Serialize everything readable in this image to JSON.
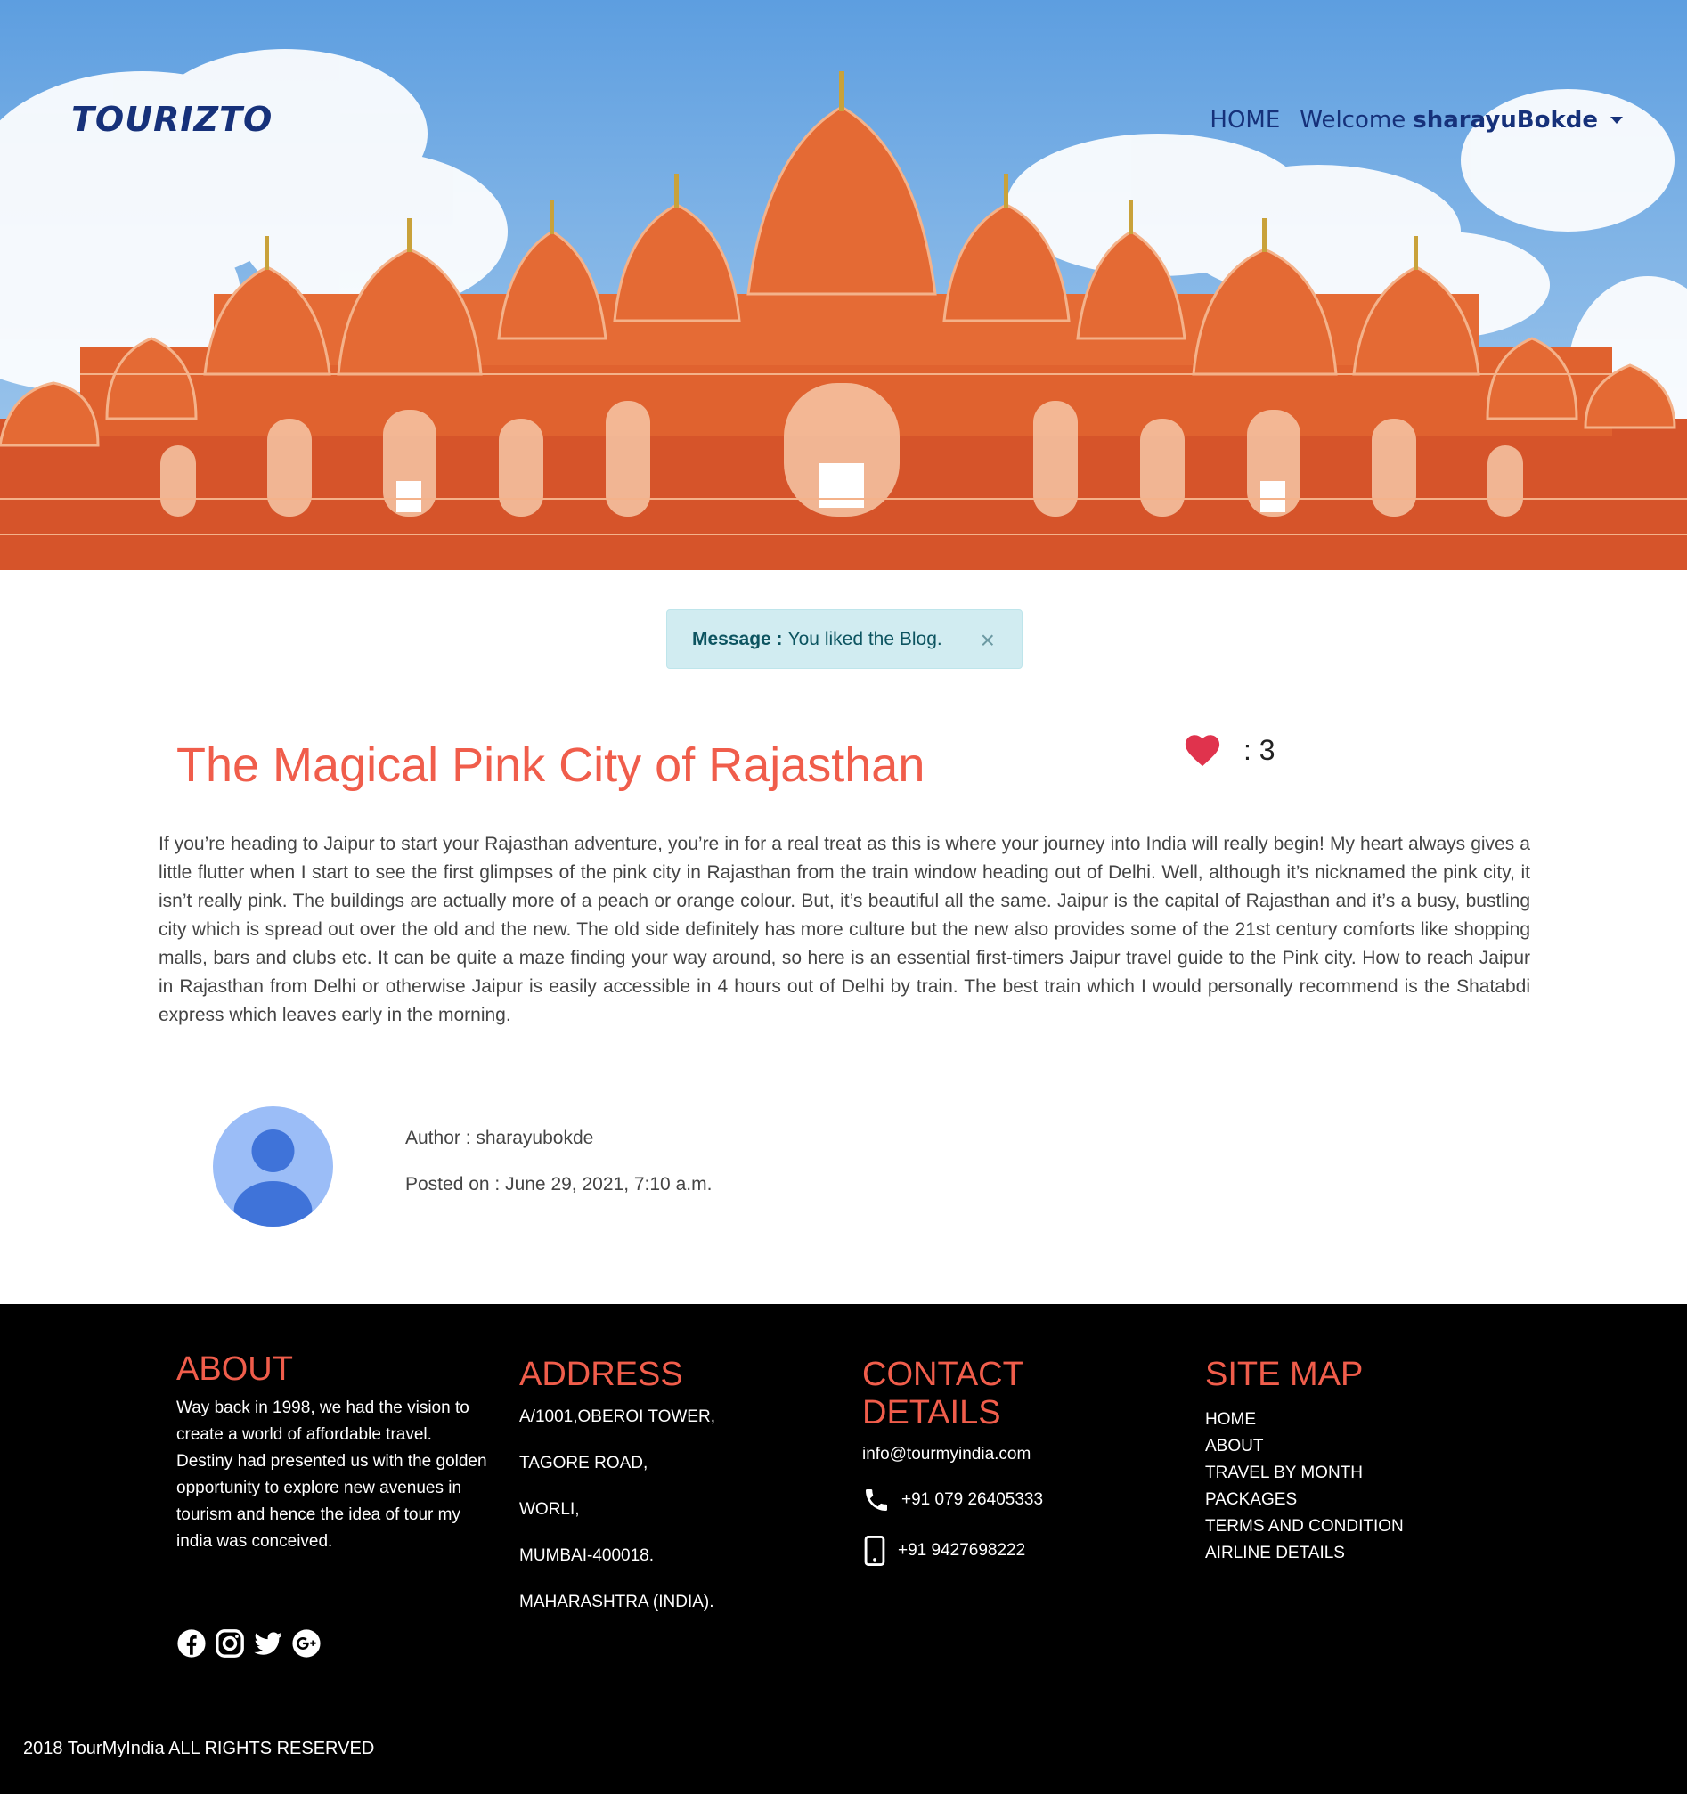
{
  "header": {
    "logo": "TOURIZTO",
    "nav_home": "HOME",
    "welcome_prefix": "Welcome",
    "username": "sharayuBokde"
  },
  "alert": {
    "label": "Message :",
    "text": "You liked the Blog.",
    "close": "×"
  },
  "blog": {
    "title": "The Magical Pink City of Rajasthan",
    "likes": ": 3",
    "body": "If you’re heading to Jaipur to start your Rajasthan adventure, you’re in for a real treat as this is where your journey into India will really begin! My heart always gives a little flutter when I start to see the first glimpses of the pink city in Rajasthan from the train window heading out of Delhi. Well, although it’s nicknamed the pink city, it isn’t really pink. The buildings are actually more of a peach or orange colour. But, it’s beautiful all the same. Jaipur is the capital of Rajasthan and it’s a busy, bustling city which is spread out over the old and the new. The old side definitely has more culture but the new also provides some of the 21st century comforts like shopping malls, bars and clubs etc. It can be quite a maze finding your way around, so here is an essential first-timers Jaipur travel guide to the Pink city. How to reach Jaipur in Rajasthan from Delhi or otherwise Jaipur is easily accessible in 4 hours out of Delhi by train. The best train which I would personally recommend is the Shatabdi express which leaves early in the morning.",
    "author": "Author : sharayubokde",
    "posted": "Posted on : June 29, 2021, 7:10 a.m."
  },
  "footer": {
    "about_title": "ABOUT",
    "about_text": "Way back in 1998, we had the vision to create a world of affordable travel. Destiny had presented us with the golden opportunity to explore new avenues in tourism and hence the idea of tour my india was conceived.",
    "address_title": "ADDRESS",
    "address_lines": [
      "A/1001,OBEROI TOWER,",
      "TAGORE ROAD,",
      "WORLI,",
      "MUMBAI-400018.",
      "MAHARASHTRA (INDIA)."
    ],
    "contact_title": "CONTACT DETAILS",
    "email": "info@tourmyindia.com",
    "phone": "+91 079 26405333",
    "mobile": "+91 9427698222",
    "sitemap_title": "SITE MAP",
    "sitemap": [
      "HOME",
      "ABOUT",
      "TRAVEL BY MONTH",
      "PACKAGES",
      "TERMS AND CONDITION",
      "AIRLINE DETAILS"
    ],
    "socials": [
      "facebook-icon",
      "instagram-icon",
      "twitter-icon",
      "google-plus-icon"
    ],
    "copyright": "2018 TourMyIndia ALL RIGHTS RESERVED"
  },
  "colors": {
    "accent": "#f05d4b",
    "nav": "#16317a",
    "alert_bg": "#d1ecf1",
    "heart": "#e0334d"
  }
}
